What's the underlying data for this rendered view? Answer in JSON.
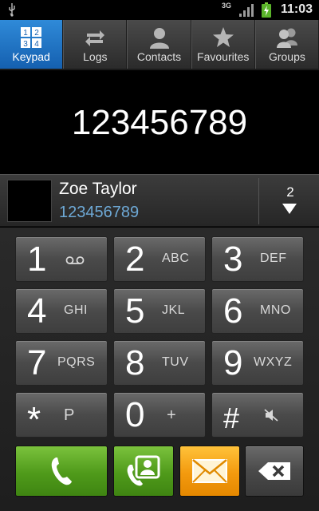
{
  "status_bar": {
    "network": "3G",
    "time": "11:03",
    "icons": [
      "usb-icon",
      "network-3g-icon",
      "signal-icon",
      "battery-charging-icon"
    ]
  },
  "tabs": [
    {
      "label": "Keypad",
      "icon": "keypad-icon",
      "active": true
    },
    {
      "label": "Logs",
      "icon": "logs-icon",
      "active": false
    },
    {
      "label": "Contacts",
      "icon": "contact-icon",
      "active": false
    },
    {
      "label": "Favourites",
      "icon": "star-icon",
      "active": false
    },
    {
      "label": "Groups",
      "icon": "groups-icon",
      "active": false
    }
  ],
  "dialed_number": "123456789",
  "match": {
    "name": "Zoe Taylor",
    "number": "123456789",
    "more_count": "2"
  },
  "keys": [
    {
      "digit": "1",
      "letters": ""
    },
    {
      "digit": "2",
      "letters": "ABC"
    },
    {
      "digit": "3",
      "letters": "DEF"
    },
    {
      "digit": "4",
      "letters": "GHI"
    },
    {
      "digit": "5",
      "letters": "JKL"
    },
    {
      "digit": "6",
      "letters": "MNO"
    },
    {
      "digit": "7",
      "letters": "PQRS"
    },
    {
      "digit": "8",
      "letters": "TUV"
    },
    {
      "digit": "9",
      "letters": "WXYZ"
    },
    {
      "digit": "*",
      "letters": "P"
    },
    {
      "digit": "0",
      "letters": "+"
    },
    {
      "digit": "#",
      "letters": ""
    }
  ],
  "colors": {
    "tab_active": "#1f74c8",
    "call_green": "#4f9a1a",
    "message_orange": "#f39a0e",
    "matched_number": "#6ea9d6"
  }
}
